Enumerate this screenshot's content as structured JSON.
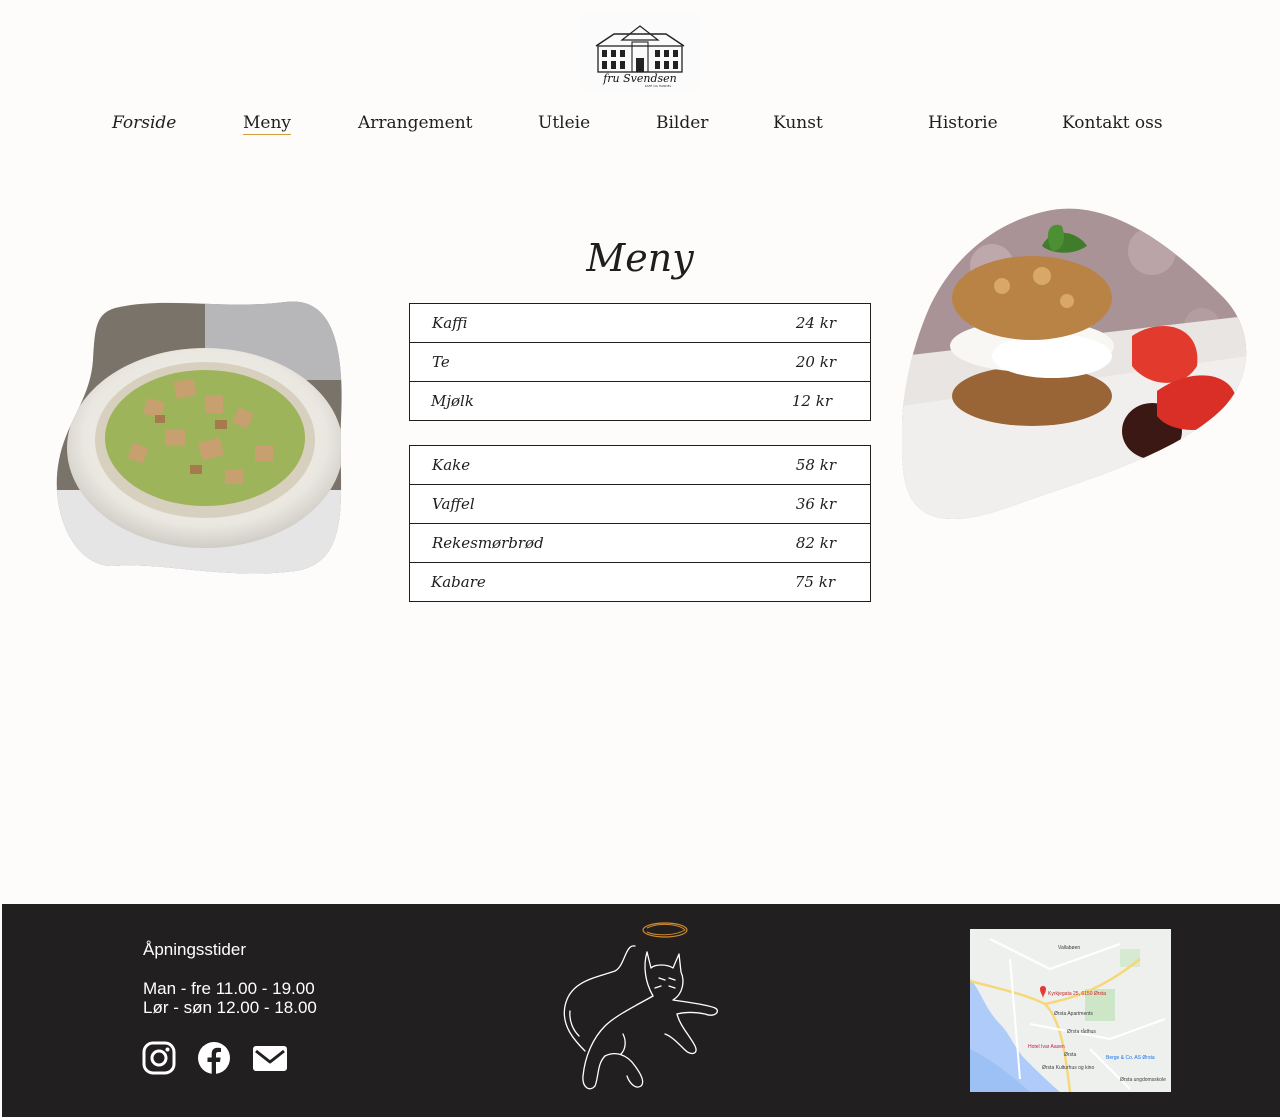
{
  "logo": {
    "name": "fru Svendsen",
    "subtitle": "KAFÉ OG HANDEL"
  },
  "nav": [
    "Forside",
    "Meny",
    "Arrangement",
    "Utleie",
    "Bilder",
    "Kunst",
    "Historie",
    "Kontakt oss"
  ],
  "nav_active": "Meny",
  "menu": {
    "title": "Meny",
    "drinks": [
      {
        "name": "Kaffi",
        "price": "24 kr"
      },
      {
        "name": "Te",
        "price": "20 kr"
      },
      {
        "name": "Mjølk",
        "price": "12 kr"
      }
    ],
    "food": [
      {
        "name": "Kake",
        "price": "58 kr"
      },
      {
        "name": "Vaffel",
        "price": "36 kr"
      },
      {
        "name": "Rekesmørbrød",
        "price": "82 kr"
      },
      {
        "name": "Kabare",
        "price": "75 kr"
      }
    ]
  },
  "footer": {
    "hours_title": "Åpningsstider",
    "hours": [
      "Man - fre 11.00 - 19.00",
      "Lør - søn 12.00 - 18.00"
    ],
    "map_labels": [
      "Vallabøen",
      "Kyrkjegata 25, 6150 Ørsta",
      "Ørsta Apartments",
      "Hotel Ivar Aasen",
      "Ørsta",
      "Berge & Co. AS Ørsta",
      "Ørsta rådhus",
      "Ørsta ungdomsskole",
      "Ørsta Kulturhus og kino"
    ]
  },
  "colors": {
    "accent": "#d59a3e",
    "footer_bg": "#221f20",
    "text": "#1f1d1e"
  }
}
